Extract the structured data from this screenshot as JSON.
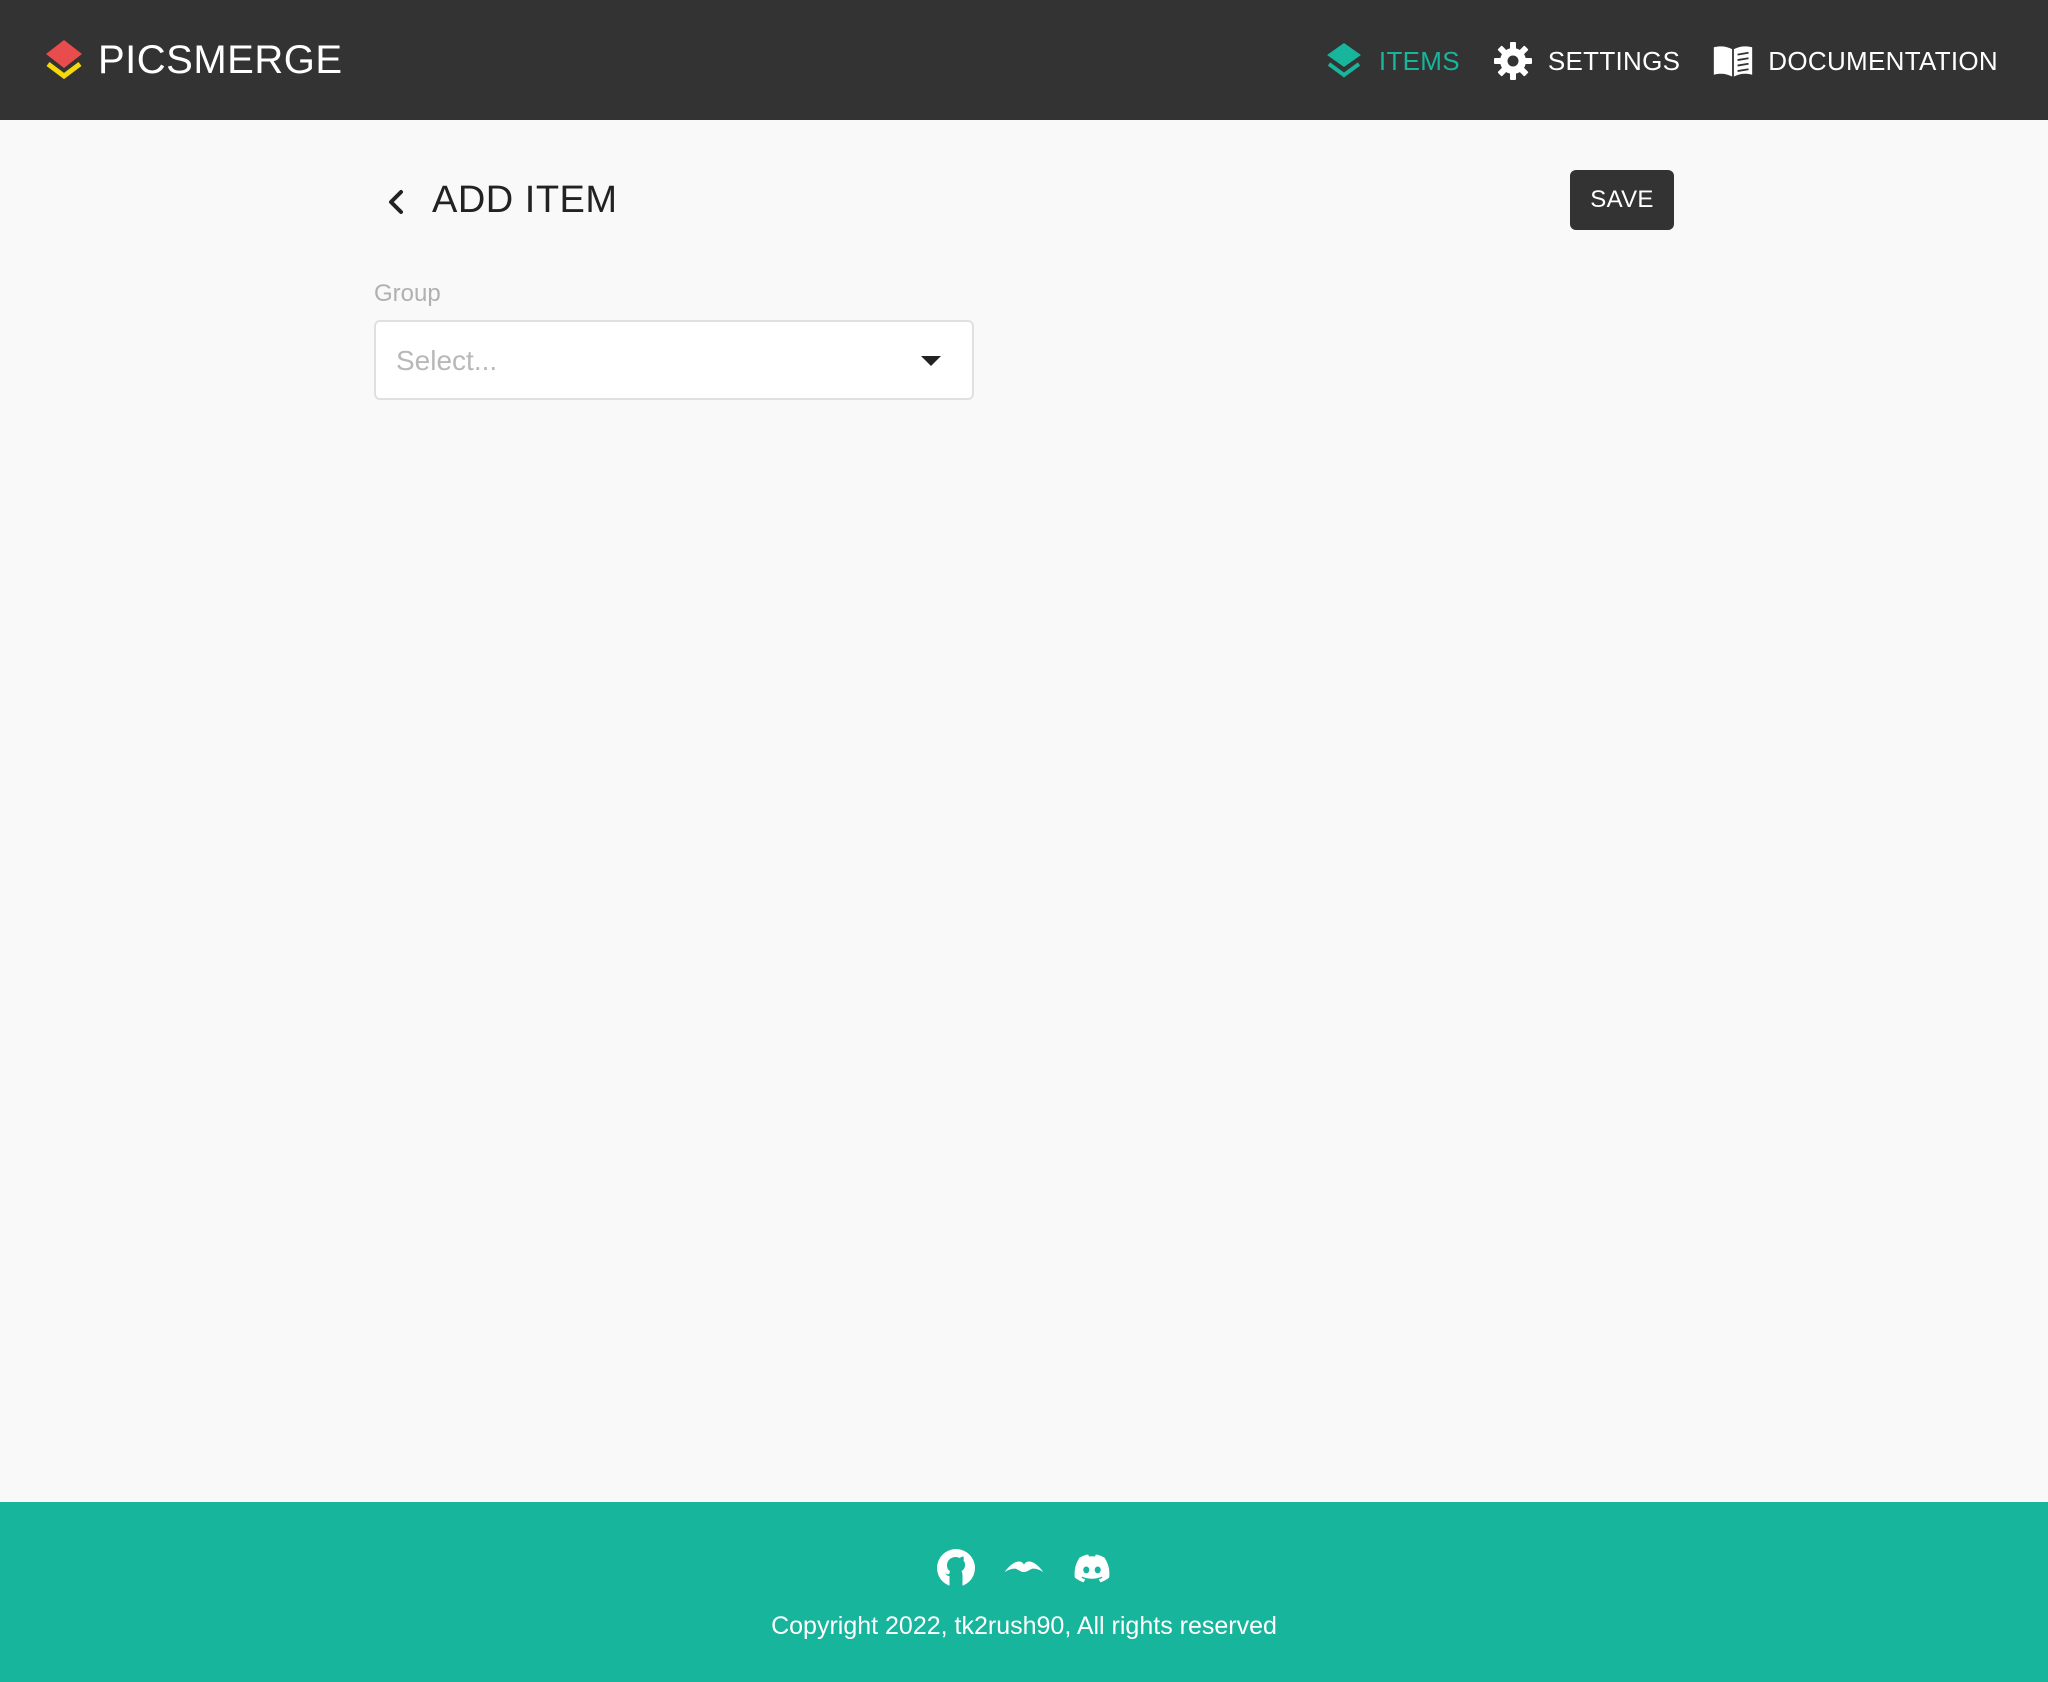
{
  "header": {
    "brand": "PICSMERGE",
    "nav": [
      {
        "label": "ITEMS",
        "icon": "layers-icon",
        "active": true
      },
      {
        "label": "SETTINGS",
        "icon": "gear-icon",
        "active": false
      },
      {
        "label": "DOCUMENTATION",
        "icon": "book-icon",
        "active": false
      }
    ]
  },
  "main": {
    "title": "ADD ITEM",
    "save_label": "SAVE",
    "group_field": {
      "label": "Group",
      "placeholder": "Select..."
    }
  },
  "footer": {
    "icons": [
      "github-icon",
      "ko-fi-icon",
      "discord-icon"
    ],
    "copyright": "Copyright 2022, tk2rush90, All rights reserved"
  },
  "colors": {
    "header_bg": "#333333",
    "accent": "#17b59b",
    "page_bg": "#f9f9f9",
    "brand_red": "#e84c4c",
    "brand_yellow": "#f5d90a"
  }
}
